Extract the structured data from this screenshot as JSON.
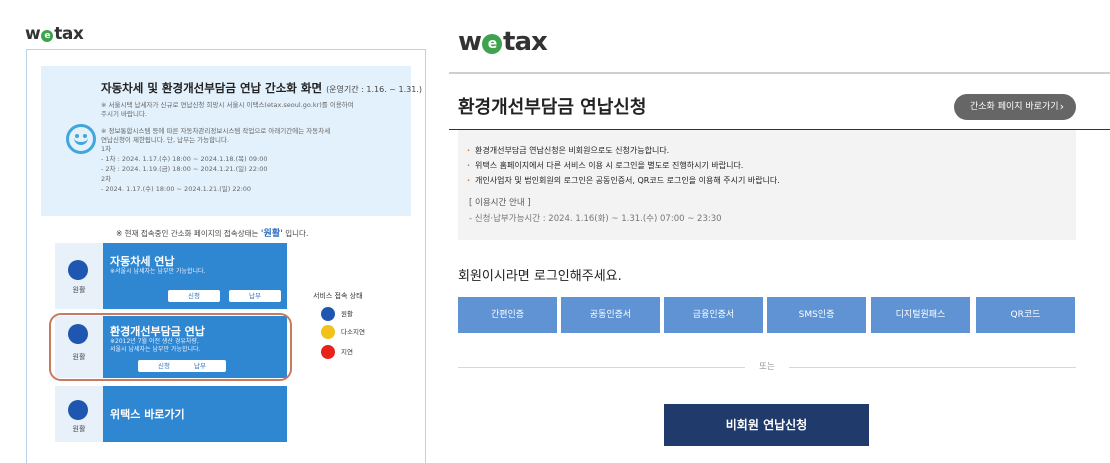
{
  "left": {
    "logo": {
      "pre": "w",
      "e": "e",
      "post": "tax"
    },
    "notice": {
      "title": "자동차세 및 환경개선부담금 연납 간소화 화면",
      "title_sub": "(운영기간 : 1.16. ~ 1.31.)",
      "lines": [
        "※ 서울시택 납세자가 신규로 연납신청 희망시 서울시 이택스(etax.seoul.go.kr)를 이용하여",
        "주시기 바랍니다.",
        "※ 정보통합시스템 등에 따른 자동차관리정보시스템 작업으로 아래기간에는 자동차세",
        "연납신청이 제한됩니다. 단, 납부는 가능합니다.",
        "1차",
        "- 1차 : 2024. 1.17.(수) 18:00 ~ 2024.1.18.(목) 09:00",
        "- 2차 : 2024. 1.19.(금) 18:00 ~ 2024.1.21.(일) 22:00",
        "2차",
        "- 2024. 1.17.(수) 18:00 ~ 2024.1.21.(일) 22:00"
      ]
    },
    "status_note": {
      "pre": "※ 현재 접속중인 간소화 페이지의 접속상태는 ",
      "status": "'원활'",
      "post": " 입니다."
    },
    "services": [
      {
        "title": "자동차세 연납",
        "desc1": "※서울시 납세자는 납부만 가능합니다.",
        "desc2": "",
        "status": "원활",
        "btn1": "신청",
        "btn2": "납부"
      },
      {
        "title": "환경개선부담금 연납",
        "desc1": "※2012년 7월 이전 생산 경유차량,",
        "desc2": "서울시 납세자는 납부만 가능합니다.",
        "status": "원활",
        "btn1": "신청",
        "btn2": "납부"
      },
      {
        "title": "위택스 바로가기",
        "desc1": "",
        "desc2": "",
        "status": "원활",
        "btn1": "",
        "btn2": ""
      }
    ],
    "legend": {
      "title": "서비스 접속 상태",
      "items": [
        {
          "label": "원활",
          "color": "#1e56b0"
        },
        {
          "label": "다소지연",
          "color": "#f2c21b"
        },
        {
          "label": "지연",
          "color": "#e8231b"
        }
      ]
    }
  },
  "right": {
    "logo": {
      "pre": "w",
      "e": "e",
      "post": "tax"
    },
    "title": "환경개선부담금 연납신청",
    "simple_page_button": "간소화 페이지 바로가기",
    "bullets": [
      "환경개선부담금 연납신청은 비회원으로도 신청가능합니다.",
      "위택스 홈페이지에서 다른 서비스 이용 시 로그인을 별도로 진행하시기 바랍니다.",
      "개인사업자 및 법인회원의 로그인은 공동인증서, QR코드 로그인을 이용해 주시기 바랍니다."
    ],
    "time_head": "[ 이용시간 안내 ]",
    "time_value": "- 신청·납부가능시간 : 2024. 1.16(화) ~ 1.31.(수) 07:00 ~ 23:30",
    "login_prompt": "회원이시라면 로그인해주세요.",
    "auth_buttons": [
      "간편인증",
      "공동인증서",
      "금융인증서",
      "SMS인증",
      "디지털원패스",
      "QR코드"
    ],
    "or_text": "또는",
    "nonmember_button": "비회원 연납신청"
  },
  "colors": {
    "accent_blue": "#2f86d1",
    "auth_blue": "#5f93d4",
    "navy": "#1f3a6b",
    "logo_green": "#3fa34d"
  }
}
